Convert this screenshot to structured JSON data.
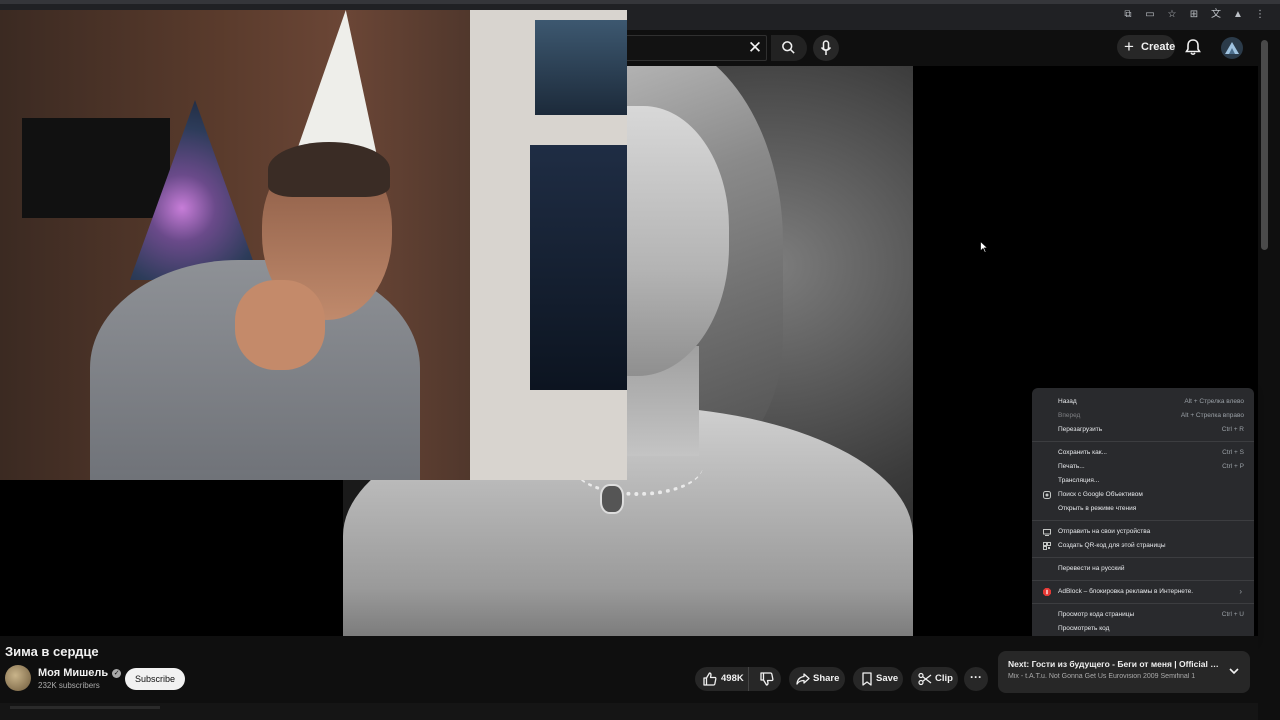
{
  "browser": {
    "toolbar_icons": [
      "open-in-new-icon",
      "cast-icon",
      "star-icon",
      "extensions-icon",
      "translate-icon",
      "profile-icon",
      "menu-icon"
    ]
  },
  "header": {
    "search_clear": "✕",
    "create_label": "Create"
  },
  "context_menu": {
    "items": [
      {
        "label": "Назад",
        "shortcut": "Alt + Стрелка влево",
        "enabled": true
      },
      {
        "label": "Вперед",
        "shortcut": "Alt + Стрелка вправо",
        "enabled": false
      },
      {
        "label": "Перезагрузить",
        "shortcut": "Ctrl + R",
        "enabled": true
      },
      {
        "label": "Сохранить как...",
        "shortcut": "Ctrl + S",
        "enabled": true
      },
      {
        "label": "Печать...",
        "shortcut": "Ctrl + P",
        "enabled": true
      },
      {
        "label": "Трансляция...",
        "shortcut": "",
        "enabled": true
      },
      {
        "label": "Поиск с Google Объективом",
        "shortcut": "",
        "enabled": true
      },
      {
        "label": "Открыть в режиме чтения",
        "shortcut": "",
        "enabled": true
      },
      {
        "label": "Отправить на свои устройства",
        "shortcut": "",
        "enabled": true
      },
      {
        "label": "Создать QR-код для этой страницы",
        "shortcut": "",
        "enabled": true
      },
      {
        "label": "Перевести на русский",
        "shortcut": "",
        "enabled": true
      },
      {
        "label": "AdBlock – блокировка рекламы в Интернете.",
        "shortcut": "",
        "enabled": true
      },
      {
        "label": "Просмотр кода страницы",
        "shortcut": "Ctrl + U",
        "enabled": true
      },
      {
        "label": "Просмотреть код",
        "shortcut": "",
        "enabled": true
      }
    ]
  },
  "video": {
    "title": "Зима в сердце"
  },
  "channel": {
    "name": "Моя Мишель",
    "verified_mark": "✓",
    "subscribers": "232K subscribers",
    "subscribe_label": "Subscribe"
  },
  "actions": {
    "likes": "498K",
    "share": "Share",
    "save": "Save",
    "clip": "Clip",
    "more": "···"
  },
  "next": {
    "prefix": "Next:",
    "title": "Гости из будущего - Беги от меня | Official V...",
    "subtitle": "Mix - t.A.T.u. Not Gonna Get Us Eurovision 2009 Semifinal 1"
  },
  "colors": {
    "background": "#0f0f0f",
    "menu": "#292a2d",
    "pill": "#272727",
    "adblock_red": "#e53935"
  }
}
